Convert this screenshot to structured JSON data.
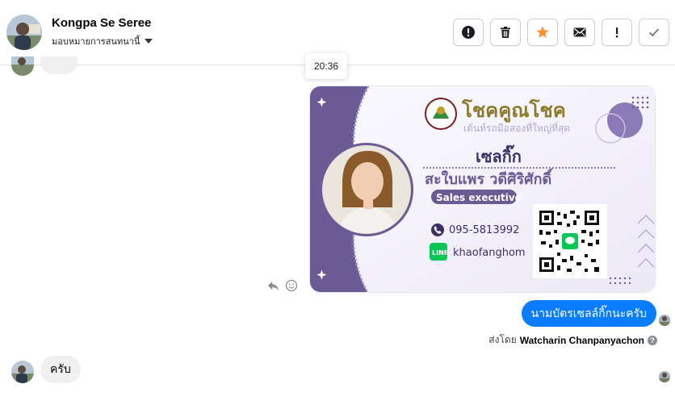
{
  "header": {
    "contact_name": "Kongpa Se Seree",
    "assign_label": "มอบหมายการสนทนานี้",
    "actions": [
      {
        "name": "report-spam-button",
        "icon": "exclamation-circle-icon"
      },
      {
        "name": "delete-button",
        "icon": "trash-icon"
      },
      {
        "name": "follow-up-button",
        "icon": "star-icon"
      },
      {
        "name": "mark-unread-button",
        "icon": "envelope-icon"
      },
      {
        "name": "mark-important-button",
        "icon": "exclamation-icon"
      },
      {
        "name": "mark-done-button",
        "icon": "checkmark-icon"
      }
    ]
  },
  "tooltip": {
    "time": "20:36"
  },
  "business_card": {
    "brand_title": "โชคคูณโชค",
    "brand_tagline": "เต้นท์รถมือสองที่ใหญ่ที่สุด",
    "nickname": "เซลกิ๊ก",
    "full_name": "สะใบแพร วดีศิริศักดิ์",
    "role": "Sales executive",
    "phone": "095-5813992",
    "line_id": "khaofanghom",
    "line_badge": "LINE",
    "accent_color": "#6b5b95"
  },
  "messages": {
    "outgoing_text": "นามบัตรเซลล์กิ๊กนะครับ",
    "sent_by_prefix": "ส่งโดย",
    "sent_by_name": "Watcharin Chanpanyachon",
    "incoming_text": "ครับ"
  },
  "colors": {
    "brand_blue": "#0a7cff",
    "star_orange": "#f7923b",
    "bubble_gray": "#f0f0f0"
  }
}
